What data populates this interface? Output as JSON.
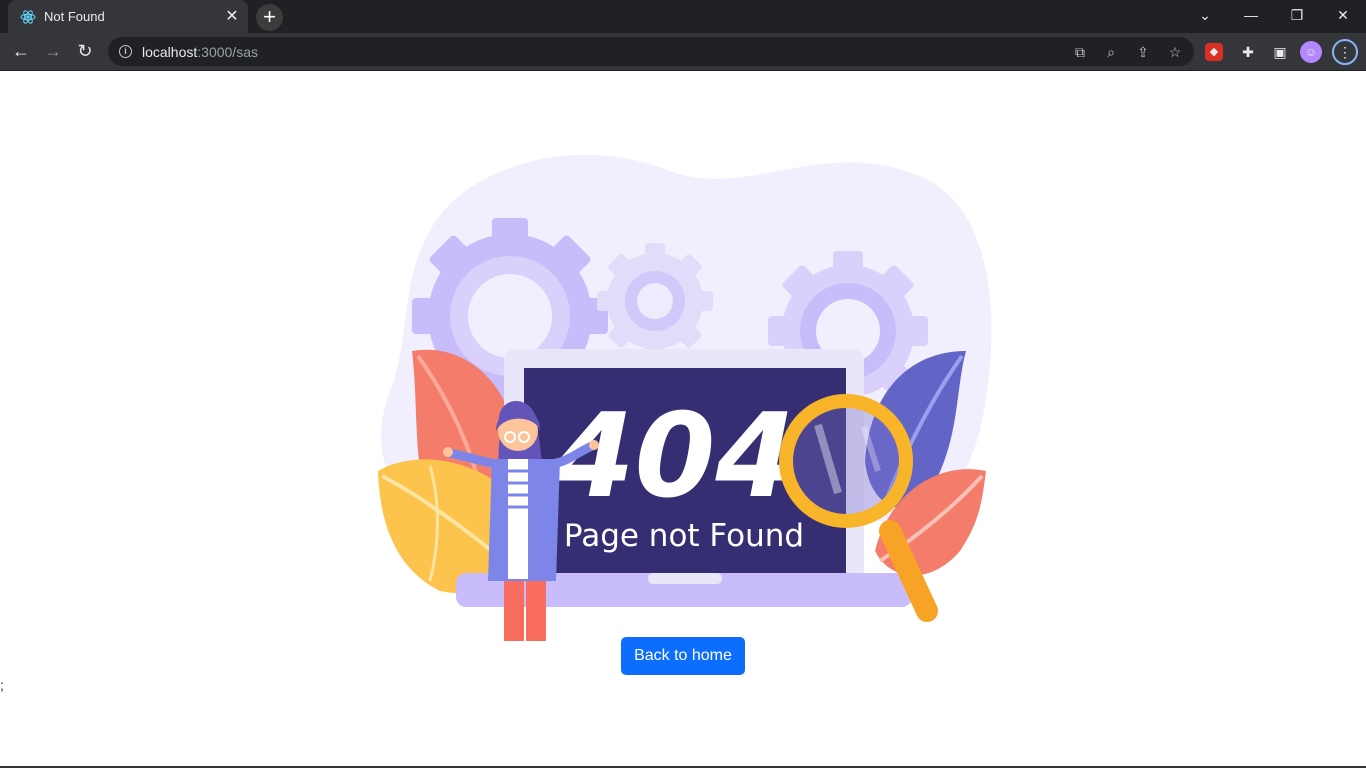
{
  "browser": {
    "tab_title": "Not Found",
    "url_host": "localhost",
    "url_path": ":3000/sas"
  },
  "page": {
    "error_code": "404",
    "error_message": "Page not Found",
    "home_button_label": "Back to home",
    "stray_text": ";"
  },
  "colors": {
    "accent": "#0d6efd",
    "screen": "#362e72",
    "gears": "#c8bcfa"
  }
}
